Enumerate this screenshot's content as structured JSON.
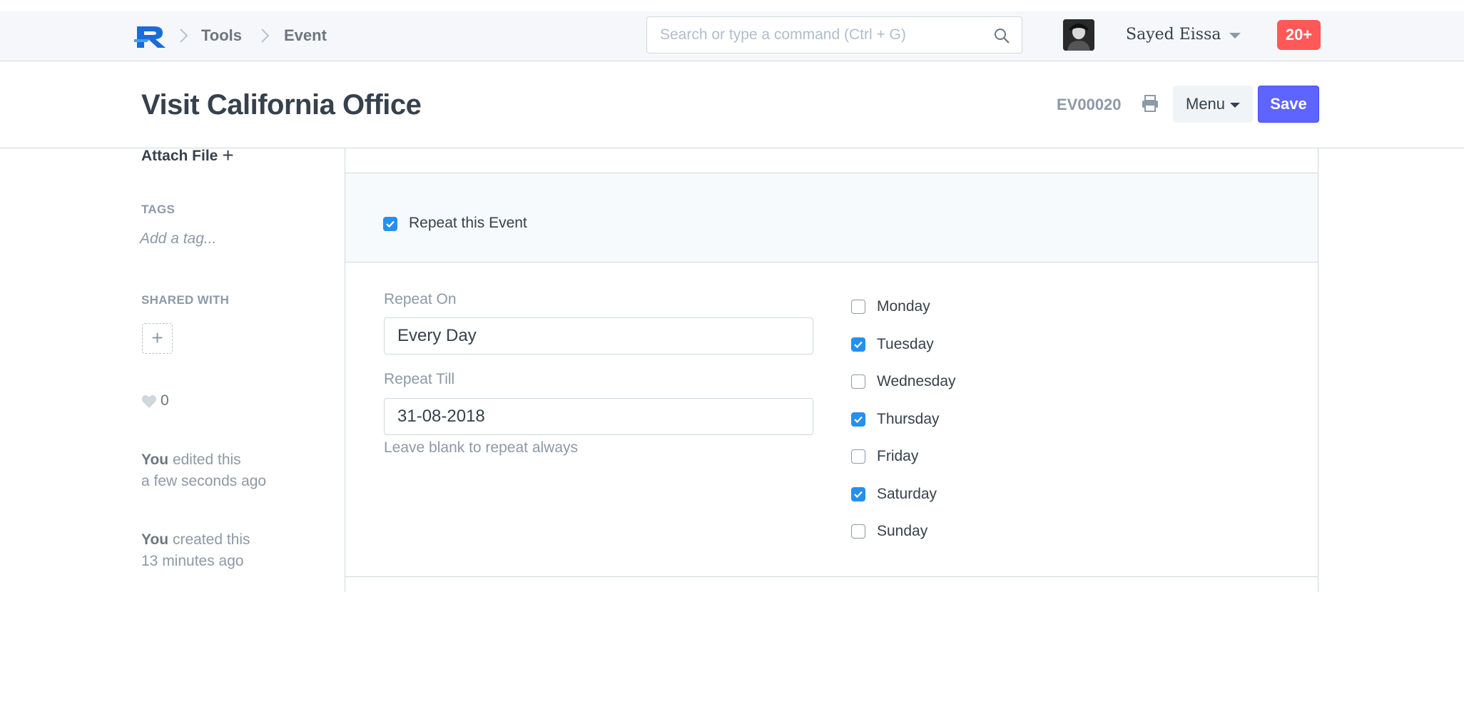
{
  "navbar": {
    "breadcrumbs": [
      "Tools",
      "Event"
    ],
    "search_placeholder": "Search or type a command (Ctrl + G)",
    "user_name": "Sayed Eissa",
    "notifications": "20+"
  },
  "page": {
    "title": "Visit California Office",
    "doc_id": "EV00020",
    "menu_label": "Menu",
    "save_label": "Save"
  },
  "sidebar": {
    "attach_label": "Attach File",
    "tags_label": "TAGS",
    "add_tag_placeholder": "Add a tag...",
    "shared_label": "SHARED WITH",
    "likes": "0",
    "activity": [
      {
        "who": "You",
        "action": "edited this",
        "when": "a few seconds ago"
      },
      {
        "who": "You",
        "action": "created this",
        "when": "13 minutes ago"
      }
    ]
  },
  "form": {
    "repeat_event": {
      "label": "Repeat this Event",
      "checked": true
    },
    "repeat_on": {
      "label": "Repeat On",
      "value": "Every Day"
    },
    "repeat_till": {
      "label": "Repeat Till",
      "value": "31-08-2018",
      "help": "Leave blank to repeat always"
    },
    "days": [
      {
        "label": "Monday",
        "checked": false
      },
      {
        "label": "Tuesday",
        "checked": true
      },
      {
        "label": "Wednesday",
        "checked": false
      },
      {
        "label": "Thursday",
        "checked": true
      },
      {
        "label": "Friday",
        "checked": false
      },
      {
        "label": "Saturday",
        "checked": true
      },
      {
        "label": "Sunday",
        "checked": false
      }
    ]
  },
  "colors": {
    "primary": "#5e64ff",
    "checkbox": "#2490ef",
    "badge": "#ff5858"
  }
}
